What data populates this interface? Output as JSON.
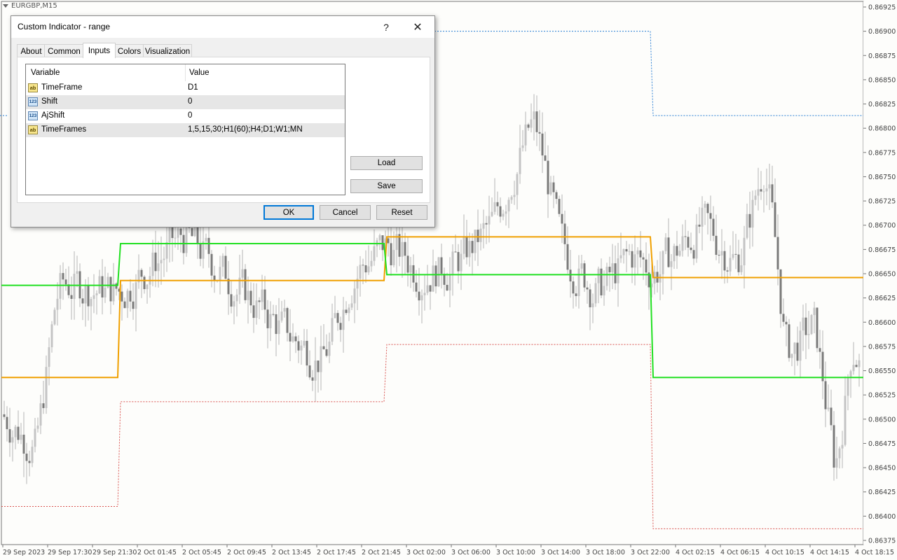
{
  "chart": {
    "symbol": "EURGBP,M15",
    "price_labels": [
      "0.86925",
      "0.86900",
      "0.86875",
      "0.86850",
      "0.86825",
      "0.86800",
      "0.86775",
      "0.86750",
      "0.86725",
      "0.86700",
      "0.86675",
      "0.86650",
      "0.86625",
      "0.86600",
      "0.86575",
      "0.86550",
      "0.86525",
      "0.86500",
      "0.86475",
      "0.86450",
      "0.86425",
      "0.86400",
      "0.86375"
    ],
    "time_labels": [
      "29 Sep 2023",
      "29 Sep 17:30",
      "29 Sep 21:30",
      "2 Oct 01:45",
      "2 Oct 05:45",
      "2 Oct 09:45",
      "2 Oct 13:45",
      "2 Oct 17:45",
      "2 Oct 21:45",
      "3 Oct 02:00",
      "3 Oct 06:00",
      "3 Oct 10:00",
      "3 Oct 14:00",
      "3 Oct 18:00",
      "3 Oct 22:00",
      "4 Oct 02:15",
      "4 Oct 06:15",
      "4 Oct 10:15",
      "4 Oct 14:15",
      "4 Oct 18:15"
    ],
    "price_range": [
      0.86375,
      0.86925
    ],
    "colors": {
      "green_line": "#22e022",
      "orange_line": "#f0a000",
      "blue_dotted": "#2a7fd4",
      "red_dotted": "#d9534f",
      "candles": "#9a9a9a"
    },
    "indicator_levels": {
      "green": [
        {
          "segment": 1,
          "value": 0.86638
        },
        {
          "segment": 2,
          "value": 0.86681
        },
        {
          "segment": 3,
          "value": 0.86649
        },
        {
          "segment": 4,
          "value": 0.86543
        }
      ],
      "orange": [
        {
          "segment": 1,
          "value": 0.86543
        },
        {
          "segment": 2,
          "value": 0.86643
        },
        {
          "segment": 3,
          "value": 0.86688
        },
        {
          "segment": 4,
          "value": 0.86646
        }
      ],
      "blue_dotted": [
        {
          "segment": 1,
          "value": 0.86813
        },
        {
          "segment": 3,
          "value": 0.869
        },
        {
          "segment": 4,
          "value": 0.86813
        }
      ],
      "red_dotted": [
        {
          "segment": 1,
          "value": 0.8641
        },
        {
          "segment": 2,
          "value": 0.86518
        },
        {
          "segment": 3,
          "value": 0.86577
        },
        {
          "segment": 4,
          "value": 0.86387
        }
      ]
    }
  },
  "dialog": {
    "title": "Custom Indicator - range",
    "help": "?",
    "close": "✕",
    "tabs": [
      "About",
      "Common",
      "Inputs",
      "Colors",
      "Visualization"
    ],
    "active_tab": "Inputs",
    "table": {
      "headers": [
        "Variable",
        "Value"
      ],
      "rows": [
        {
          "icon": "ab",
          "variable": "TimeFrame",
          "value": "D1"
        },
        {
          "icon": "123",
          "variable": "Shift",
          "value": "0"
        },
        {
          "icon": "123",
          "variable": "AjShift",
          "value": "0"
        },
        {
          "icon": "ab",
          "variable": "TimeFrames",
          "value": "1,5,15,30;H1(60);H4;D1;W1;MN"
        }
      ]
    },
    "buttons": {
      "load": "Load",
      "save": "Save",
      "ok": "OK",
      "cancel": "Cancel",
      "reset": "Reset"
    }
  }
}
